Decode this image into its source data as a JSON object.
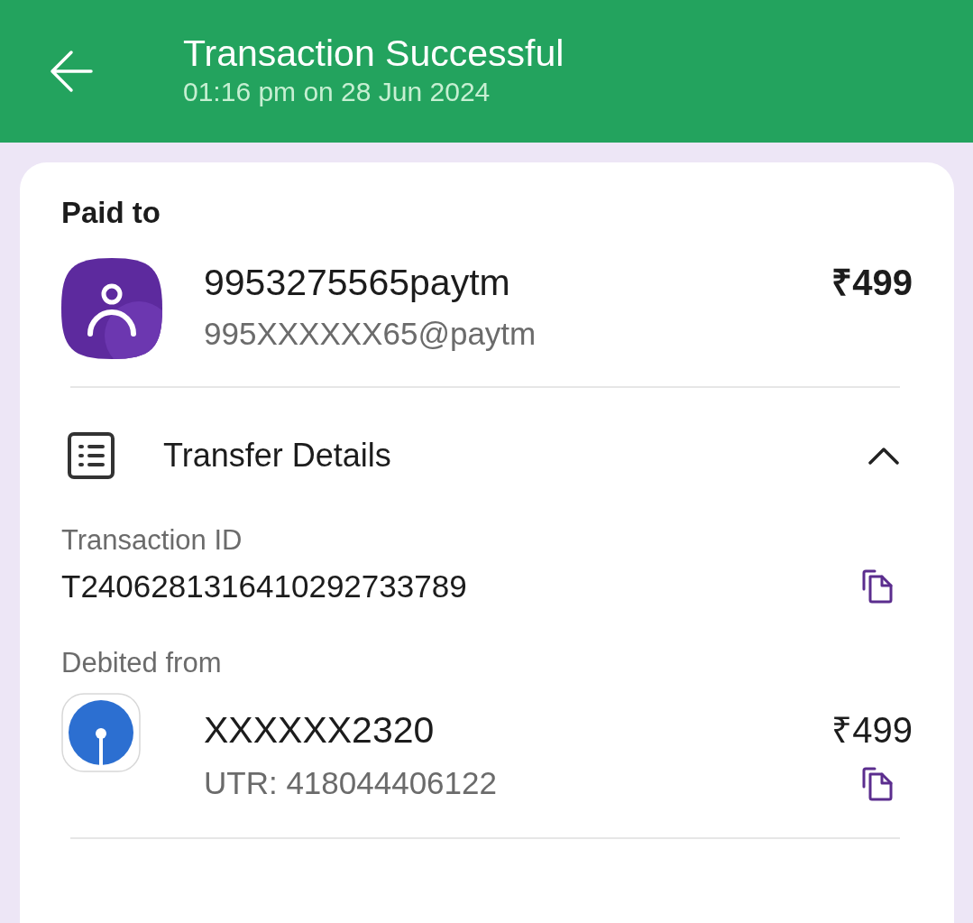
{
  "header": {
    "title": "Transaction Successful",
    "subtitle": "01:16 pm on 28 Jun 2024"
  },
  "paid_to": {
    "label": "Paid to",
    "name": "9953275565paytm",
    "upi_id": "995XXXXXX65@paytm",
    "amount": "₹499"
  },
  "transfer_details": {
    "title": "Transfer Details",
    "expanded": true,
    "transaction_id": {
      "label": "Transaction ID",
      "value": "T2406281316410292733789"
    },
    "debited_from": {
      "label": "Debited from",
      "account": "XXXXXX2320",
      "amount": "₹499",
      "utr": "UTR: 418044406122"
    }
  }
}
